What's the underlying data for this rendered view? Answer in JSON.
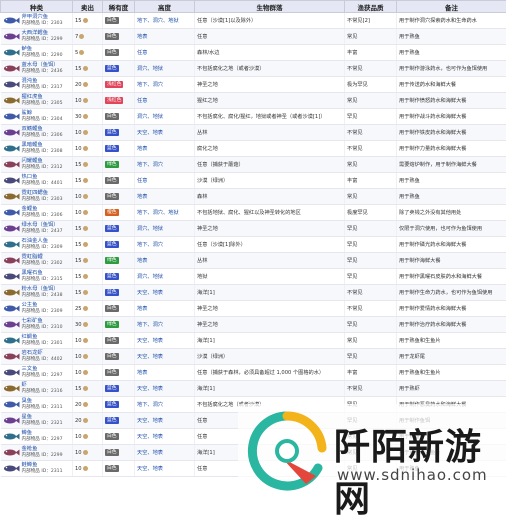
{
  "headers": [
    "种类",
    "卖出",
    "稀有度",
    "高度",
    "生物群落",
    "渔获品质",
    "备注"
  ],
  "colors": {
    "white": "#6a6a6a",
    "blue": "#3652c9",
    "green": "#2e9b3e",
    "orange": "#d6601f",
    "lightred": "#e0465a",
    "pink": "#d63fa8",
    "header": "#e5e8f4"
  },
  "rows": [
    {
      "name": "斧甲洞穴鱼",
      "id": "内部物品 ID：2303",
      "sell": "15",
      "rarity": "白色",
      "rc": "white",
      "height": "地下、洞穴、地狱",
      "biome": "任意（沙漠[1]以及除外）",
      "quality": "不常见[2]",
      "note": "用于制作洞穴探索药水和生命药水"
    },
    {
      "name": "大西洋鳕鱼",
      "id": "内部物品 ID：2299",
      "sell": "7",
      "rarity": "白色",
      "rc": "white",
      "height": "地表",
      "biome": "任意",
      "quality": "常见",
      "note": "用于熟鱼"
    },
    {
      "name": "鲈鱼",
      "id": "内部物品 ID：2290",
      "sell": "5",
      "rarity": "白色",
      "rc": "white",
      "height": "任意",
      "biome": "森林/水边",
      "quality": "丰富",
      "note": "用于熟鱼"
    },
    {
      "name": "蓝水母（鱼饵）",
      "id": "内部物品 ID：2436",
      "sell": "15",
      "rarity": "蓝色",
      "rc": "blue",
      "height": "洞穴、地狱",
      "biome": "不包括腐化之地（或者沙漠）",
      "quality": "不常见",
      "note": "用于制作游泳药水，也可作为鱼饵使用"
    },
    {
      "name": "混沌鱼",
      "id": "内部物品 ID：2317",
      "sell": "20",
      "rarity": "浅红色",
      "rc": "lightred",
      "height": "地下、洞穴",
      "biome": "神圣之地",
      "quality": "极为罕见",
      "note": "用于传送药水和海鲜大餐"
    },
    {
      "name": "猩红虎鱼",
      "id": "内部物品 ID：2305",
      "sell": "10",
      "rarity": "浅红色",
      "rc": "lightred",
      "height": "任意",
      "biome": "猩红之地",
      "quality": "常见",
      "note": "用于制作愤怒药水和海鲜大餐"
    },
    {
      "name": "鲨鲸",
      "id": "内部物品 ID：2304",
      "sell": "30",
      "rarity": "白色",
      "rc": "white",
      "height": "洞穴、地狱",
      "biome": "不包括腐化、腐化/猩红，地狱或者神圣（或者沙漠[1]）",
      "quality": "罕见",
      "note": "用于制作战斗药水和海鲜大餐"
    },
    {
      "name": "双鳍鲤鱼",
      "id": "内部物品 ID：2306",
      "sell": "10",
      "rarity": "蓝色",
      "rc": "blue",
      "height": "天空、地表",
      "biome": "丛林",
      "quality": "不常见",
      "note": "用于制作铁皮药水和海鲜大餐"
    },
    {
      "name": "黑暗鲤鱼",
      "id": "内部物品 ID：2308",
      "sell": "10",
      "rarity": "蓝色",
      "rc": "blue",
      "height": "地表",
      "biome": "腐化之地",
      "quality": "不常见",
      "note": "用于制作力量药水和海鲜大餐"
    },
    {
      "name": "闪耀鲤鱼",
      "id": "内部物品 ID：2312",
      "sell": "15",
      "rarity": "绿色",
      "rc": "green",
      "height": "地下、洞穴",
      "biome": "任意（捕获于蘑菇）",
      "quality": "常见",
      "note": "需要熔炉制作，用于制作海鲜大餐"
    },
    {
      "name": "热口鱼",
      "id": "内部物品 ID：4401",
      "sell": "15",
      "rarity": "白色",
      "rc": "white",
      "height": "任意",
      "biome": "沙漠（绿洲）",
      "quality": "丰富",
      "note": "用于熟鱼"
    },
    {
      "name": "霓虹四鳃鱼",
      "id": "内部物品 ID：2303",
      "sell": "10",
      "rarity": "白色",
      "rc": "white",
      "height": "地表",
      "biome": "森林",
      "quality": "常见",
      "note": "用于熟鱼"
    },
    {
      "name": "金鲤鱼",
      "id": "内部物品 ID：2306",
      "sell": "10",
      "rarity": "橙色",
      "rc": "orange",
      "height": "地下、洞穴、地狱",
      "biome": "不包括地狱、腐化、猩红以及神圣转化的地区",
      "quality": "极度罕见",
      "note": "除了卖钱之外没有其他用处"
    },
    {
      "name": "绿水母（鱼饵）",
      "id": "内部物品 ID：2437",
      "sell": "15",
      "rarity": "蓝色",
      "rc": "blue",
      "height": "洞穴、地狱",
      "biome": "神圣之地",
      "quality": "罕见",
      "note": "仅限于洞穴使用，也可作为鱼饵使用"
    },
    {
      "name": "石油金人鱼",
      "id": "内部物品 ID：2309",
      "sell": "15",
      "rarity": "蓝色",
      "rc": "blue",
      "height": "地下、洞穴",
      "biome": "任意（沙漠[1]除外）",
      "quality": "罕见",
      "note": "用于制作磷光药水和海鲜大餐"
    },
    {
      "name": "霓虹脂鲤",
      "id": "内部物品 ID：2302",
      "sell": "15",
      "rarity": "绿色",
      "rc": "green",
      "height": "地表",
      "biome": "丛林",
      "quality": "罕见",
      "note": "用于制作海鲜大餐"
    },
    {
      "name": "黑曜石鱼",
      "id": "内部物品 ID：2315",
      "sell": "15",
      "rarity": "蓝色",
      "rc": "blue",
      "height": "洞穴、地狱",
      "biome": "地狱",
      "quality": "罕见",
      "note": "用于制作黑曜石皮肤药水和海鲜大餐"
    },
    {
      "name": "粉水母（鱼饵）",
      "id": "内部物品 ID：2438",
      "sell": "15",
      "rarity": "蓝色",
      "rc": "blue",
      "height": "天空、地表",
      "biome": "海洋[1]",
      "quality": "不常见",
      "note": "用于制作生命力药水，也可作为鱼饵使用"
    },
    {
      "name": "公主鱼",
      "id": "内部物品 ID：2309",
      "sell": "25",
      "rarity": "白色",
      "rc": "white",
      "height": "地表",
      "biome": "神圣之地",
      "quality": "不常见",
      "note": "用于制作爱情药水和海鲜大餐"
    },
    {
      "name": "七彩矿鱼",
      "id": "内部物品 ID：2310",
      "sell": "30",
      "rarity": "绿色",
      "rc": "green",
      "height": "地下、洞穴",
      "biome": "神圣之地",
      "quality": "罕见",
      "note": "用于制作治疗药水和海鲜大餐"
    },
    {
      "name": "红鲷鱼",
      "id": "内部物品 ID：2301",
      "sell": "10",
      "rarity": "白色",
      "rc": "white",
      "height": "天空、地表",
      "biome": "海洋[1]",
      "quality": "常见",
      "note": "用于熟鱼和生鱼片"
    },
    {
      "name": "岩石龙虾",
      "id": "内部物品 ID：4402",
      "sell": "10",
      "rarity": "白色",
      "rc": "white",
      "height": "天空、地表",
      "biome": "沙漠（绿洲）",
      "quality": "罕见",
      "note": "用于龙虾尾"
    },
    {
      "name": "三文鱼",
      "id": "内部物品 ID：2297",
      "sell": "10",
      "rarity": "白色",
      "rc": "white",
      "height": "地表",
      "biome": "任意（捕获于森林，必须具备超过 1,000 个图格的水）",
      "quality": "丰富",
      "note": "用于熟鱼和生鱼片"
    },
    {
      "name": "虾",
      "id": "内部物品 ID：2316",
      "sell": "15",
      "rarity": "蓝色",
      "rc": "blue",
      "height": "天空、地表",
      "biome": "海洋[1]",
      "quality": "不常见",
      "note": "用于熟虾"
    },
    {
      "name": "臭鱼",
      "id": "内部物品 ID：2311",
      "sell": "20",
      "rarity": "蓝色",
      "rc": "blue",
      "height": "地下、洞穴",
      "biome": "不包括腐化之地（或者沙漠）",
      "quality": "罕见",
      "note": "用于制作恶臭药水和海鲜大餐"
    },
    {
      "name": "星鱼",
      "id": "内部物品 ID：2321",
      "sell": "20",
      "rarity": "蓝色",
      "rc": "blue",
      "height": "天空、地表",
      "biome": "任意",
      "quality": "罕见",
      "note": "用于制作鱼饵"
    },
    {
      "name": "鳟鱼",
      "id": "内部物品 ID：2297",
      "sell": "10",
      "rarity": "白色",
      "rc": "white",
      "height": "天空、地表",
      "biome": "任意",
      "quality": "常见",
      "note": "用于熟鱼"
    },
    {
      "name": "金枪鱼",
      "id": "内部物品 ID：2299",
      "sell": "10",
      "rarity": "白色",
      "rc": "white",
      "height": "天空、地表",
      "biome": "海洋[1]",
      "quality": "常见",
      "note": "用于熟鱼和生鱼片"
    },
    {
      "name": "鲑鳟鱼",
      "id": "内部物品 ID：2311",
      "sell": "10",
      "rarity": "白色",
      "rc": "white",
      "height": "天空、地表",
      "biome": "任意",
      "quality": "常见",
      "note": "用于熟鱼"
    }
  ],
  "watermark": {
    "title": "阡陌新游网",
    "url": "www.sdnihao.com"
  }
}
